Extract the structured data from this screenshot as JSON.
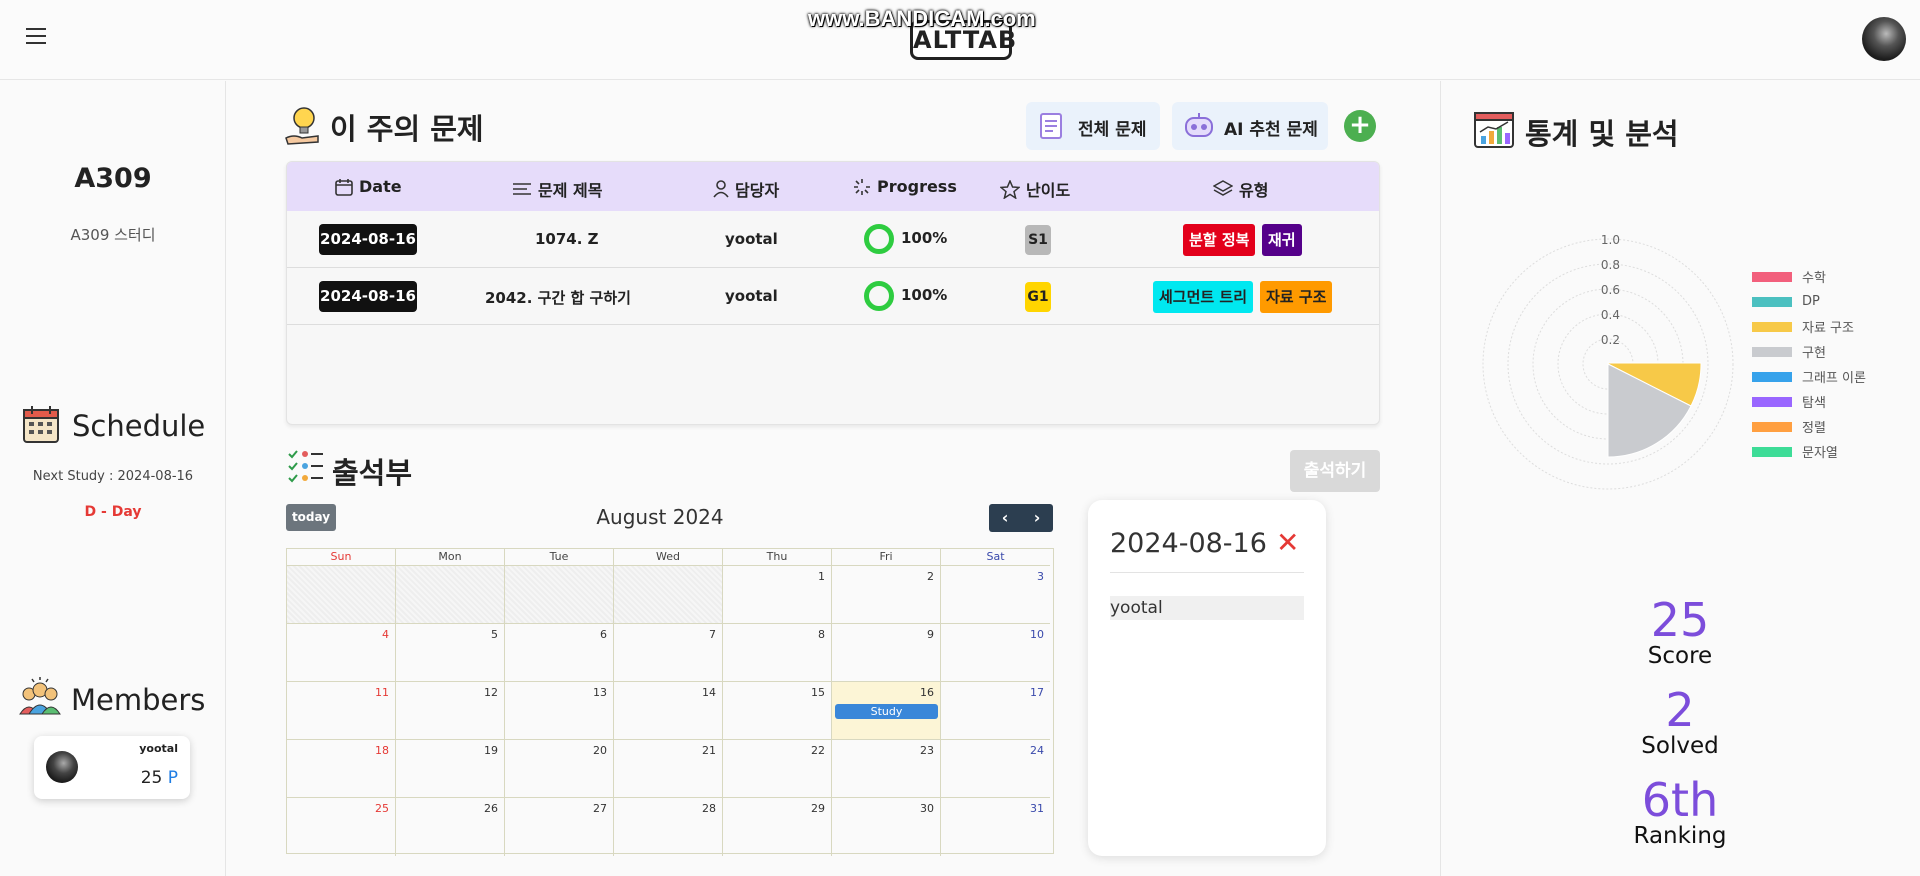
{
  "header": {
    "logo": "ALTTAB",
    "watermark": "www.BANDICAM.com"
  },
  "sidebar": {
    "study_name": "A309",
    "study_sub": "A309 스터디",
    "schedule_title": "Schedule",
    "next_study": "Next Study : 2024-08-16",
    "dday": "D - Day",
    "members_title": "Members",
    "members": [
      {
        "name": "yootal",
        "score": "25",
        "unit": "P"
      }
    ]
  },
  "problems": {
    "title": "이 주의 문제",
    "all_button": "전체 문제",
    "ai_button": "AI 추천 문제",
    "add_button": "+",
    "columns": [
      "Date",
      "문제 제목",
      "담당자",
      "Progress",
      "난이도",
      "유형"
    ],
    "rows": [
      {
        "date": "2024-08-16",
        "title": "1074. Z",
        "assignee": "yootal",
        "progress": "100%",
        "tier": "S1",
        "tags": [
          "분할 정복",
          "재귀"
        ]
      },
      {
        "date": "2024-08-16",
        "title": "2042. 구간 합 구하기",
        "assignee": "yootal",
        "progress": "100%",
        "tier": "G1",
        "tags": [
          "세그먼트 트리",
          "자료 구조"
        ]
      }
    ]
  },
  "attendance": {
    "title": "출석부",
    "check_button": "출석하기",
    "today_button": "today",
    "month": "August 2024",
    "prev": "‹",
    "next": "›",
    "weekdays": [
      "Sun",
      "Mon",
      "Tue",
      "Wed",
      "Thu",
      "Fri",
      "Sat"
    ],
    "weeks": [
      [
        "",
        "",
        "",
        "",
        "1",
        "2",
        "3"
      ],
      [
        "4",
        "5",
        "6",
        "7",
        "8",
        "9",
        "10"
      ],
      [
        "11",
        "12",
        "13",
        "14",
        "15",
        "16",
        "17"
      ],
      [
        "18",
        "19",
        "20",
        "21",
        "22",
        "23",
        "24"
      ],
      [
        "25",
        "26",
        "27",
        "28",
        "29",
        "30",
        "31"
      ]
    ],
    "event_label": "Study",
    "selected_date": "2024-08-16",
    "close_icon": "✕",
    "attendees": [
      "yootal"
    ]
  },
  "stats": {
    "title": "통계 및 분석",
    "radar_ticks": [
      "1.0",
      "0.8",
      "0.6",
      "0.4",
      "0.2"
    ],
    "legend": [
      {
        "label": "수학",
        "color": "#f25f7c"
      },
      {
        "label": "DP",
        "color": "#4bc0c0"
      },
      {
        "label": "자료 구조",
        "color": "#f7c948"
      },
      {
        "label": "구현",
        "color": "#c9cbcf"
      },
      {
        "label": "그래프 이론",
        "color": "#36a2eb"
      },
      {
        "label": "탐색",
        "color": "#9966ff"
      },
      {
        "label": "정렬",
        "color": "#ff9f40"
      },
      {
        "label": "문자열",
        "color": "#3ddc97"
      }
    ],
    "score": "25",
    "score_label": "Score",
    "solved": "2",
    "solved_label": "Solved",
    "ranking": "6th",
    "ranking_label": "Ranking"
  }
}
